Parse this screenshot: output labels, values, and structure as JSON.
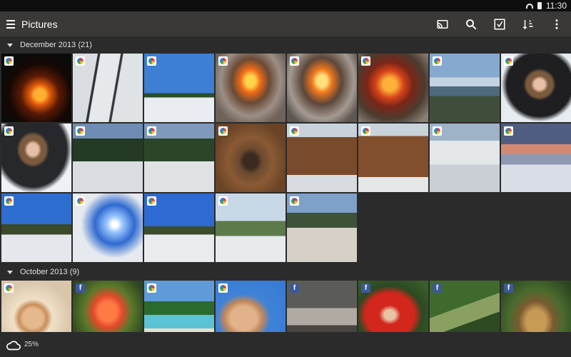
{
  "status_bar": {
    "time": "11:30"
  },
  "action_bar": {
    "title": "Pictures",
    "actions": [
      "cast-icon",
      "search-icon",
      "select-icon",
      "sort-icon",
      "more-icon"
    ]
  },
  "sections": [
    {
      "label": "December 2013 (21)",
      "photos": [
        {
          "badge": "gallery",
          "bg": "radial-gradient(circle at 55% 60%, #ffb030 0 10%, #e25b0d 18%, #5a1a05 34%, #150804 55%, #0b0b0b 75%)"
        },
        {
          "badge": "gallery",
          "bg": "linear-gradient(100deg, #d9dde2 0 30%, #2c2f34 31% 33%, #e6e9ec 34% 58%, #34373c 59% 61%, #dfe3e6 62%)"
        },
        {
          "badge": "gallery",
          "bg": "linear-gradient(180deg, #3d7fd3 0 58%, #2a4e2a 58% 64%, #e9edf1 64%)"
        },
        {
          "badge": "gallery",
          "bg": "radial-gradient(ellipse at 50% 40%, #ffd34a 0 10%, #f06b17 20%, #6a4a35 38%, #9b8f86 60%, #6e625a 80%)"
        },
        {
          "badge": "gallery",
          "bg": "radial-gradient(ellipse at 50% 40%, #ffe07a 0 10%, #f2781d 20%, #5c463a 40%, #a49a92 65%, #5e5650 85%)"
        },
        {
          "badge": "gallery",
          "bg": "radial-gradient(ellipse at 45% 45%, #ffb03a 0 12%, #d4421a 26%, #7a2618 42%, #4c3c30 65%, #8a8076 90%)"
        },
        {
          "badge": "gallery",
          "bg": "linear-gradient(180deg, #86a9cf 0 35%, #c5d3e3 35% 48%, #4e6a7c 48% 62%, #3f4e3a 62%)"
        },
        {
          "badge": "gallery",
          "bg": "radial-gradient(ellipse at 55% 45%, #e7bfa6 0 10%, #7b5a3e 16% 24%, #1f1f22 30% 60%, #e6ecf2 70%)"
        }
      ]
    },
    {
      "label": "",
      "photos": [
        {
          "badge": "gallery",
          "bg": "radial-gradient(ellipse at 45% 38%, #e7bfa6 0 10%, #7b5a3e 16% 24%, #26282c 30% 62%, #eef2f6 72%)"
        },
        {
          "badge": "gallery",
          "bg": "linear-gradient(180deg, #6f8db4 0 22%, #243a24 22% 55%, #d9dde2 55%)"
        },
        {
          "badge": "gallery",
          "bg": "linear-gradient(180deg, #7e99bb 0 22%, #2c4529 22% 55%, #dfe2e4 55%)"
        },
        {
          "badge": "gallery",
          "bg": "radial-gradient(ellipse at 50% 55%, #3b2a20 0 14%, #6c4a2f 24%, #8a5a34 45%, #6a4426 75%)"
        },
        {
          "badge": "gallery",
          "bg": "linear-gradient(180deg, #c8d2da 0 20%, #7a4a2c 20% 75%, #d8dce0 75%)"
        },
        {
          "badge": "gallery",
          "bg": "linear-gradient(180deg, #c9d3dc 0 18%, #824f2e 18% 78%, #e4e6e8 78%)"
        },
        {
          "badge": "gallery",
          "bg": "linear-gradient(180deg, #9fb3c8 0 25%, #e3e7ea 25% 60%, #c9cfd5 60%)"
        },
        {
          "badge": "gallery",
          "bg": "linear-gradient(180deg, #4f5e80 0 30%, #d48a70 30% 45%, #8e98b3 45% 60%, #d9dde6 60%)"
        }
      ]
    },
    {
      "label": "",
      "photos": [
        {
          "badge": "gallery",
          "bg": "linear-gradient(180deg, #2e6ed0 0 45%, #3a4a2a 45% 60%, #e4e8ec 60%)"
        },
        {
          "badge": "gallery",
          "bg": "radial-gradient(circle at 60% 45%, #ffffff 0 5%, #9cc7ff 14%, #2f6ad0 35%, #e6eaee 60%)"
        },
        {
          "badge": "gallery",
          "bg": "linear-gradient(180deg, #2d6ad2 0 48%, #3b4d2d 48% 60%, #e8ecef 60%)"
        },
        {
          "badge": "gallery",
          "bg": "linear-gradient(180deg, #c9d8e6 0 40%, #5d7a4a 40% 62%, #e7ebee 62%)"
        },
        {
          "badge": "gallery",
          "bg": "linear-gradient(180deg, #7fa0c8 0 28%, #3d5238 28% 50%, #d6d0c6 50%)"
        }
      ]
    },
    {
      "label": "October 2013 (9)",
      "photos": [
        {
          "badge": "gallery",
          "bg": "radial-gradient(ellipse at 45% 55%, #e6b98d 0 18%, #c98f5a 26%, #f0e0c8 36%, #d9c6aa 70%)"
        },
        {
          "badge": "facebook",
          "bg": "radial-gradient(ellipse at 50% 45%, #ff7a45 0 18%, #e2492a 30%, #5a7a2a 48%, #2f4420 80%)"
        },
        {
          "badge": "gallery",
          "bg": "linear-gradient(180deg, #5e9bd8 0 30%, #2b6a2f 30% 50%, #5cc2d6 50% 70%, #e6dfcd 70%)"
        },
        {
          "badge": "gallery",
          "bg": "radial-gradient(ellipse at 40% 55%, #e2b38b 0 22%, #c08859 32%, #3f82d6 45%, #3579d4 100%)"
        },
        {
          "badge": "facebook",
          "bg": "linear-gradient(180deg, #5b5b58 0 40%, #b0aaa2 40% 65%, #4a4540 65%)"
        },
        {
          "badge": "facebook",
          "bg": "radial-gradient(ellipse at 45% 50%, #e8c4a4 0 10%, #d3261c 20% 45%, #2b4a22 60%, #3a5e2c 90%)"
        },
        {
          "badge": "facebook",
          "bg": "linear-gradient(160deg, #3e6a2e 0 40%, #8aa060 40% 60%, #2e4a22 60%)"
        },
        {
          "badge": "facebook",
          "bg": "radial-gradient(ellipse at 50% 60%, #c79a55 0 20%, #7a5a30 35%, #4a6b2e 55%, #2c4520 90%)"
        }
      ]
    }
  ],
  "footer": {
    "sync_percent": "25%"
  }
}
